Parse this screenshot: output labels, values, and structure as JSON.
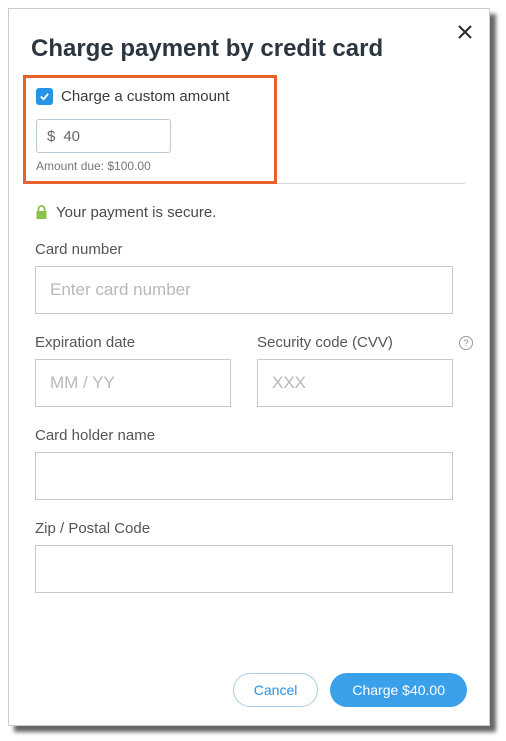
{
  "title": "Charge payment by credit card",
  "customAmount": {
    "checkboxLabel": "Charge a custom amount",
    "currencySymbol": "$",
    "amountValue": "40",
    "amountDueLabel": "Amount due: $100.00"
  },
  "secure": {
    "text": "Your payment is secure."
  },
  "cardNumber": {
    "label": "Card number",
    "placeholder": "Enter card number"
  },
  "expiration": {
    "label": "Expiration date",
    "placeholder": "MM / YY"
  },
  "cvv": {
    "label": "Security code (CVV)",
    "placeholder": "XXX"
  },
  "cardHolder": {
    "label": "Card holder name"
  },
  "zip": {
    "label": "Zip / Postal Code"
  },
  "buttons": {
    "cancel": "Cancel",
    "charge": "Charge $40.00"
  },
  "helpTooltip": "?"
}
